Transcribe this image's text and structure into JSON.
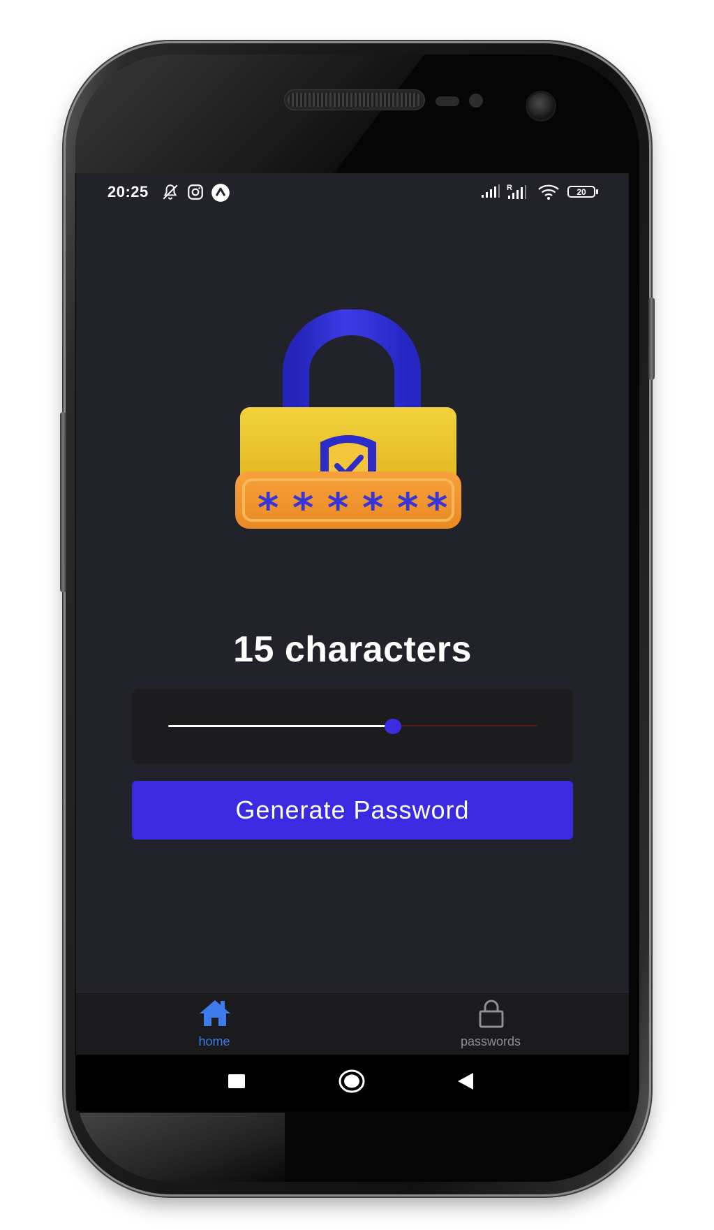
{
  "status_bar": {
    "time": "20:25",
    "battery": "20",
    "left_icons": [
      "bell-off-icon",
      "instagram-icon",
      "app-notification-icon"
    ],
    "right_icons": [
      "signal-icon",
      "roaming-signal-icon",
      "wifi-icon",
      "battery-icon"
    ]
  },
  "main": {
    "illustration": "padlock-icon",
    "length_heading": "15 characters",
    "slider": {
      "value": 15,
      "fill_fraction": 0.61
    },
    "generate_button_label": "Generate Password"
  },
  "tab_bar": {
    "tabs": [
      {
        "label": "home",
        "icon": "home-icon",
        "active": true
      },
      {
        "label": "passwords",
        "icon": "lock-icon",
        "active": false
      }
    ]
  },
  "nav_bar": {
    "icons": [
      "recent-apps-icon",
      "home-circle-icon",
      "back-icon"
    ]
  },
  "colors": {
    "screen_bg": "#22222b",
    "accent": "#3a2be3",
    "active_tab": "#3d7bea",
    "inactive_tab": "#8e8e93"
  }
}
